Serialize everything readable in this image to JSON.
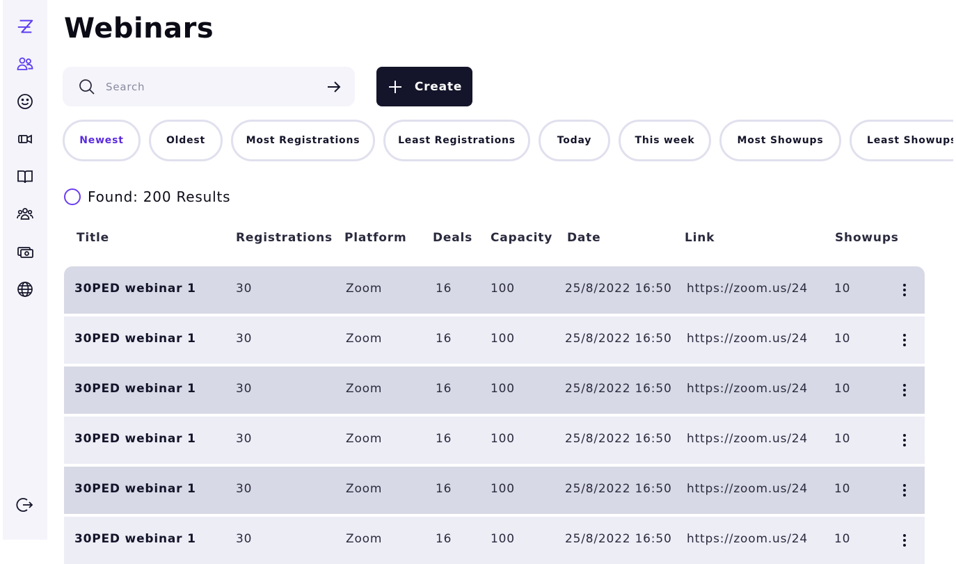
{
  "page": {
    "title": "Webinars"
  },
  "search": {
    "placeholder": "Search",
    "value": ""
  },
  "create_button": {
    "label": "Create"
  },
  "filters": [
    {
      "label": "Newest",
      "active": true
    },
    {
      "label": "Oldest",
      "active": false
    },
    {
      "label": "Most Registrations",
      "active": false
    },
    {
      "label": "Least Registrations",
      "active": false
    },
    {
      "label": "Today",
      "active": false
    },
    {
      "label": "This week",
      "active": false
    },
    {
      "label": "Most  Showups",
      "active": false
    },
    {
      "label": "Least  Showups",
      "active": false
    }
  ],
  "results": {
    "text": "Found: 200 Results"
  },
  "table": {
    "columns": [
      "Title",
      "Registrations",
      "Platform",
      "Deals",
      "Capacity",
      "Date",
      "Link",
      "Showups"
    ],
    "rows": [
      {
        "title": "30PED webinar 1",
        "registrations": "30",
        "platform": "Zoom",
        "deals": "16",
        "capacity": "100",
        "date": "25/8/2022 16:50",
        "link": "https://zoom.us/24",
        "showups": "10"
      },
      {
        "title": "30PED webinar 1",
        "registrations": "30",
        "platform": "Zoom",
        "deals": "16",
        "capacity": "100",
        "date": "25/8/2022 16:50",
        "link": "https://zoom.us/24",
        "showups": "10"
      },
      {
        "title": "30PED webinar 1",
        "registrations": "30",
        "platform": "Zoom",
        "deals": "16",
        "capacity": "100",
        "date": "25/8/2022 16:50",
        "link": "https://zoom.us/24",
        "showups": "10"
      },
      {
        "title": "30PED webinar 1",
        "registrations": "30",
        "platform": "Zoom",
        "deals": "16",
        "capacity": "100",
        "date": "25/8/2022 16:50",
        "link": "https://zoom.us/24",
        "showups": "10"
      },
      {
        "title": "30PED webinar 1",
        "registrations": "30",
        "platform": "Zoom",
        "deals": "16",
        "capacity": "100",
        "date": "25/8/2022 16:50",
        "link": "https://zoom.us/24",
        "showups": "10"
      },
      {
        "title": "30PED webinar 1",
        "registrations": "30",
        "platform": "Zoom",
        "deals": "16",
        "capacity": "100",
        "date": "25/8/2022 16:50",
        "link": "https://zoom.us/24",
        "showups": "10"
      }
    ]
  },
  "sidebar": {
    "icons": [
      "logo-icon",
      "contacts-icon",
      "smiley-icon",
      "video-icon",
      "book-icon",
      "community-icon",
      "money-icon",
      "globe-icon",
      "logout-icon"
    ]
  },
  "colors": {
    "accent": "#5b2be0",
    "dark": "#14142a",
    "row_dark": "#d8d9e6",
    "row_light": "#ededf6"
  }
}
